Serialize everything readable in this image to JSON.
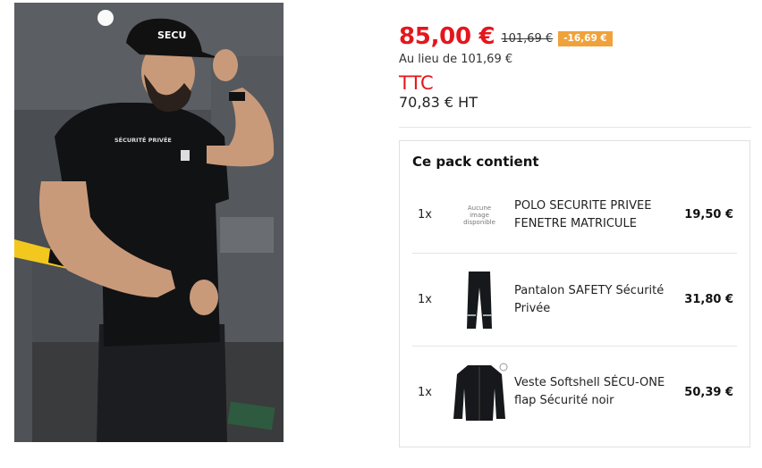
{
  "product_image": {
    "alt": "",
    "cap_text": "SECU",
    "shirt_text": "SÉCURITÉ PRIVÉE"
  },
  "price": {
    "current": "85,00 €",
    "old": "101,69 €",
    "discount": "-16,69 €",
    "instead_of": "Au lieu de 101,69 €",
    "tax_label": "TTC",
    "ht": "70,83 € HT"
  },
  "pack": {
    "title": "Ce pack contient",
    "items": [
      {
        "qty": "1x",
        "no_image_text": "Aucune image disponible",
        "name": "POLO SECURITE PRIVEE FENETRE MATRICULE",
        "price": "19,50 €",
        "icon": "no-image-icon"
      },
      {
        "qty": "1x",
        "name": "Pantalon SAFETY Sécurité Privée",
        "price": "31,80 €",
        "icon": "trousers-icon"
      },
      {
        "qty": "1x",
        "name": "Veste Softshell SÉCU-ONE flap Sécurité noir",
        "price": "50,39 €",
        "icon": "jacket-icon"
      }
    ]
  },
  "colors": {
    "price_red": "#e4161c",
    "badge_orange": "#f0a23a"
  }
}
